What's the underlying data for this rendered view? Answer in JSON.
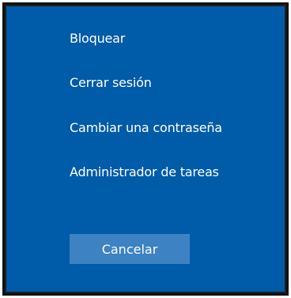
{
  "menu": {
    "items": [
      {
        "label": "Bloquear"
      },
      {
        "label": "Cerrar sesión"
      },
      {
        "label": "Cambiar una contraseña"
      },
      {
        "label": "Administrador de tareas"
      }
    ]
  },
  "cancel_button": {
    "label": "Cancelar"
  },
  "colors": {
    "background": "#005ba8",
    "button": "#3d82c2",
    "text": "#ffffff",
    "frame": "#111111"
  }
}
